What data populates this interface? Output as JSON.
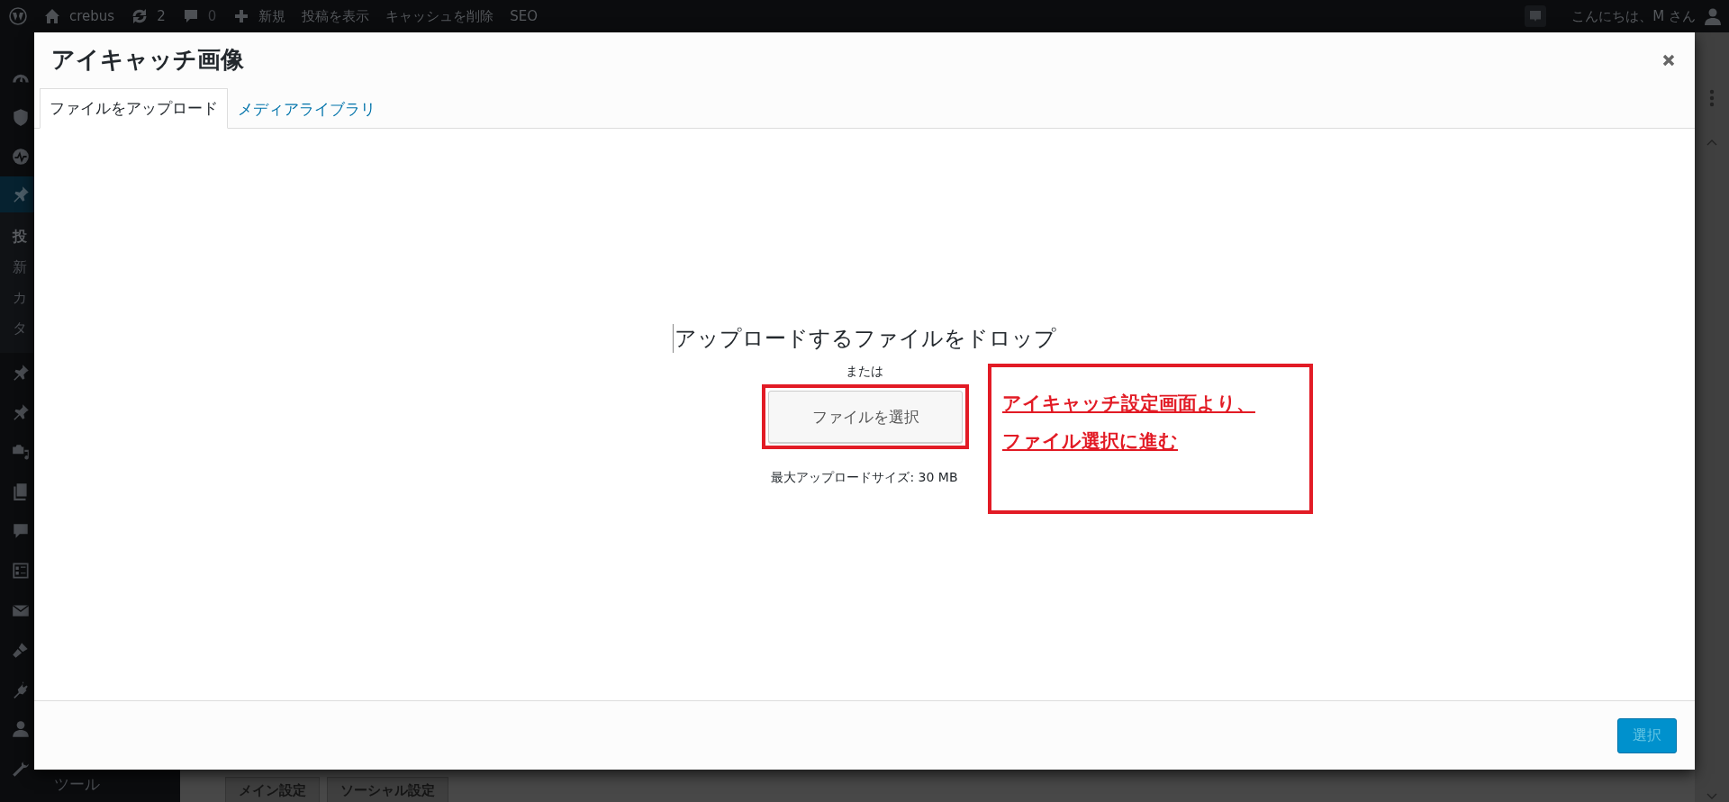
{
  "admin_bar": {
    "site": "crebus",
    "updates": "2",
    "comments": "0",
    "new": "新規",
    "links": [
      "投稿を表示",
      "キャッシュを削除",
      "SEO"
    ],
    "greeting": "こんにちは、M さん"
  },
  "sidebar": {
    "items": [
      {
        "kind": "dashboard"
      },
      {
        "kind": "shield"
      },
      {
        "kind": "activity"
      },
      {
        "kind": "pin",
        "selected": true
      },
      {
        "kind": "pin",
        "selected": false
      },
      {
        "kind": "pin",
        "selected": false
      },
      {
        "kind": "media",
        "selected": false
      },
      {
        "kind": "pages",
        "selected": false
      },
      {
        "kind": "comment",
        "selected": false
      },
      {
        "kind": "form",
        "selected": false
      },
      {
        "kind": "mail",
        "selected": false
      },
      {
        "kind": "brush",
        "selected": false
      },
      {
        "kind": "plugin",
        "selected": false
      },
      {
        "kind": "user",
        "selected": false
      },
      {
        "kind": "wrench",
        "selected": false
      }
    ],
    "submenu": [
      {
        "label": "投",
        "current": true
      },
      {
        "label": "新",
        "current": false
      },
      {
        "label": "カ",
        "current": false
      },
      {
        "label": "タ",
        "current": false
      }
    ],
    "tools_label": "ツール"
  },
  "page_tabs": [
    "メイン設定",
    "ソーシャル設定"
  ],
  "modal": {
    "title": "アイキャッチ画像",
    "tabs": [
      {
        "label": "ファイルをアップロード",
        "selected": true
      },
      {
        "label": "メディアライブラリ",
        "selected": false
      }
    ],
    "uploader": {
      "drop_text": "アップロードするファイルをドロップ",
      "or": "または",
      "button": "ファイルを選択",
      "max_size": "最大アップロードサイズ: 30 MB"
    },
    "annotation": {
      "lines": [
        "アイキャッチ設定画面より、",
        "ファイル選択に進む"
      ]
    },
    "footer_button": {
      "label": "選択",
      "disabled": true
    }
  }
}
